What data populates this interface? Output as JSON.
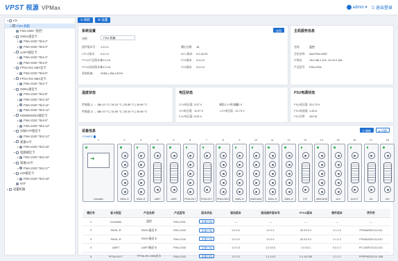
{
  "app": {
    "brand": "VPST",
    "brand_cn": "视源",
    "product": "VPMax",
    "user": "admin",
    "logout": "退出登录"
  },
  "toolbar": {
    "refresh": "刷新",
    "settings": "设置"
  },
  "tree": [
    {
      "label": "HX",
      "depth": 0,
      "type": "root",
      "tw": "▾"
    },
    {
      "label": "FWx-机箱",
      "depth": 1,
      "type": "root",
      "tw": "▾",
      "selected": true
    },
    {
      "label": "FWx-2000 \"监控\"",
      "depth": 2,
      "type": "dev",
      "tw": ""
    },
    {
      "label": "SWXL接近卡",
      "depth": 2,
      "type": "grp",
      "tw": "▾"
    },
    {
      "label": "FWx-2100 \"Slot 2\"",
      "depth": 3,
      "type": "dev",
      "tw": "▸"
    },
    {
      "label": "FWx-2100 \"Slot 3\"",
      "depth": 3,
      "type": "dev",
      "tw": "▸"
    },
    {
      "label": "UART接近卡",
      "depth": 2,
      "type": "grp",
      "tw": "▾"
    },
    {
      "label": "FWx-2100 \"Slot 4\"",
      "depth": 3,
      "type": "dev",
      "tw": "▸"
    },
    {
      "label": "FWx-2100 \"Slot 5\"",
      "depth": 3,
      "type": "dev",
      "tw": "▸"
    },
    {
      "label": "FPGA-R4 UMA近卡",
      "depth": 2,
      "type": "grp",
      "tw": "▾"
    },
    {
      "label": "FWx-2100 \"Slot 6\"",
      "depth": 3,
      "type": "dev",
      "tw": "▸"
    },
    {
      "label": "FPGA-R4 HMA近卡",
      "depth": 2,
      "type": "grp",
      "tw": "▾"
    },
    {
      "label": "FWx-2100 \"Slot 7\"",
      "depth": 3,
      "type": "dev",
      "tw": "▸"
    },
    {
      "label": "SWKL接近卡",
      "depth": 2,
      "type": "grp",
      "tw": "▾"
    },
    {
      "label": "FWx-2100 \"Slot 8\"",
      "depth": 3,
      "type": "dev",
      "tw": "▸"
    },
    {
      "label": "FWx-2100 \"Slot 10\"",
      "depth": 3,
      "type": "dev",
      "tw": "▸"
    },
    {
      "label": "FWx-2100 \"Slot 11\"",
      "depth": 3,
      "type": "dev",
      "tw": "▸"
    },
    {
      "label": "FWx-2100 \"Slot 12\"",
      "depth": 3,
      "type": "dev",
      "tw": "▸"
    },
    {
      "label": "HDMI/MODIO接近卡",
      "depth": 2,
      "type": "grp",
      "tw": "▾"
    },
    {
      "label": "FWx-2100 \"Slot 9\"",
      "depth": 3,
      "type": "dev",
      "tw": "▸"
    },
    {
      "label": "FWx-2100 \"Slot 13\"",
      "depth": 3,
      "type": "dev",
      "tw": "▸"
    },
    {
      "label": "分帧CTF接近卡",
      "depth": 2,
      "type": "grp",
      "tw": "▾"
    },
    {
      "label": "FWx-2100 \"Slot 14\"",
      "depth": 3,
      "type": "dev",
      "tw": "▸"
    },
    {
      "label": "高速AI卡",
      "depth": 2,
      "type": "grp",
      "tw": "▾"
    },
    {
      "label": "FWx-2100 \"Slot 15\"",
      "depth": 3,
      "type": "dev",
      "tw": "▸"
    },
    {
      "label": "电源接近卡",
      "depth": 2,
      "type": "grp",
      "tw": "▾"
    },
    {
      "label": "FWx-2100 \"Slot 16\"",
      "depth": 3,
      "type": "dev",
      "tw": "▸"
    },
    {
      "label": "高速AO卡",
      "depth": 2,
      "type": "grp",
      "tw": "▾"
    },
    {
      "label": "FWx-2100 \"Slot 17\"",
      "depth": 3,
      "type": "dev",
      "tw": "▸"
    },
    {
      "label": "CDI接近卡",
      "depth": 2,
      "type": "grp",
      "tw": "▾"
    },
    {
      "label": "FWx-2100 \"Slot 18\"",
      "depth": 3,
      "type": "dev",
      "tw": "▸"
    },
    {
      "label": "NTF",
      "depth": 2,
      "type": "dev",
      "tw": ""
    },
    {
      "label": "设置机箱",
      "depth": 0,
      "type": "root",
      "tw": "▸"
    }
  ],
  "sys": {
    "title": "系统设置",
    "apply": "应用",
    "name_label": "名称",
    "name_value": "FWx-机箱",
    "rows_left": [
      {
        "k": "固件版本号",
        "v": "1.0.0.1"
      },
      {
        "k": "CPLD版本",
        "v": "0.0.0.2"
      },
      {
        "k": "FPGA产品版本号",
        "v": "0.0.2.15"
      },
      {
        "k": "FPGA测试版本号",
        "v": "0.0.2.15"
      },
      {
        "k": "系统机箱",
        "v": "ZX65-LJ9A-LZ0Y0"
      }
    ],
    "rows_right": [
      {
        "k": "槽位总数",
        "v": "18"
      },
      {
        "k": "MCU版本",
        "v": "0.0.18.23"
      },
      {
        "k": "PCB版本",
        "v": "0.0.0.0"
      },
      {
        "k": "PCB版本",
        "v": "0.0.0.0"
      }
    ]
  },
  "host": {
    "title": "主机服务信息",
    "rows": [
      {
        "k": "名称",
        "v": "监控"
      },
      {
        "k": "主机名称",
        "v": "Null-FWx-0087"
      },
      {
        "k": "IP地址",
        "v": "192.168.1.101, 10.23.2.164"
      },
      {
        "k": "产品型号",
        "v": "FWx-2201"
      }
    ]
  },
  "temp": {
    "title": "温度状态",
    "rows": [
      {
        "k": "传感器 (1 → 4)",
        "v": "34.10 °C | 34.10 °C | 32.80 °C | 34.60 °C"
      },
      {
        "k": "传感器 (5 → 8)",
        "v": "30.10 °C | 31.60 °C | 34.10 °C | 30.60 °C"
      }
    ]
  },
  "volt": {
    "title": "电压状态",
    "rows": [
      {
        "k": "3.3V电压值",
        "v": "3.37 V",
        "k2": "辅助3.3V电压值",
        "v2": "3.32 V"
      },
      {
        "k": "12V电压值",
        "v": "11.97 V",
        "k2": "-12V电压值",
        "v2": "-12.73 V"
      },
      {
        "k": "5.0V电压值",
        "v": "5.02 V",
        "k2": "",
        "v2": ""
      }
    ]
  },
  "psu": {
    "title": "PSU电源状态",
    "rows": [
      {
        "k": "PSU电压值",
        "v": "221.70 V"
      },
      {
        "k": "PSU电流值",
        "v": "1.43 A"
      },
      {
        "k": "PSU功率",
        "v": "244 W"
      }
    ]
  },
  "devinfo": {
    "title": "设备信息",
    "power": "POWER",
    "btn_refresh": "刷新",
    "btn_toggle": "切换",
    "controller_label": "Controller",
    "cards": [
      {
        "num": "2",
        "label": "SWXL-R",
        "kind": "ports"
      },
      {
        "num": "3",
        "label": "SWXL-R",
        "kind": "ports"
      },
      {
        "num": "4",
        "label": "UART",
        "kind": "dsub"
      },
      {
        "num": "5",
        "label": "UART",
        "kind": "dsub"
      },
      {
        "num": "6",
        "label": "FPGA-R4 T",
        "kind": "ports"
      },
      {
        "num": "7",
        "label": "FPGA-R4 T",
        "kind": "dsub"
      },
      {
        "num": "8",
        "label": "FPGA-HM R",
        "kind": "ports"
      },
      {
        "num": "9",
        "label": "SWKL-R",
        "kind": "ports"
      },
      {
        "num": "10",
        "label": "HDMI-MOD",
        "kind": "ports"
      },
      {
        "num": "11",
        "label": "SWKL-R",
        "kind": "ports"
      },
      {
        "num": "12",
        "label": "SWKL-R",
        "kind": "ports"
      },
      {
        "num": "13",
        "label": "CTF",
        "kind": "dsub"
      },
      {
        "num": "14",
        "label": "HDMI-MOD",
        "kind": "ports"
      },
      {
        "num": "15",
        "label": "AI-5",
        "kind": "ports"
      },
      {
        "num": "16",
        "label": "AI-5 CT",
        "kind": "dsub"
      },
      {
        "num": "17",
        "label": "AO",
        "kind": "dsub"
      },
      {
        "num": "18",
        "label": "CDI",
        "kind": "dsub"
      }
    ],
    "table_headers": [
      "槽位号",
      "板卡类型",
      "产品名称",
      "产品型号",
      "版本状态",
      "驱动版本",
      "驱动固件版本号",
      "FPGA版本",
      "硬件版本",
      "序列号"
    ],
    "rows": [
      [
        "1",
        "Controller",
        "监控",
        "FWx-2201",
        "正常工作",
        "—",
        "—",
        "—",
        "—",
        "—"
      ],
      [
        "2",
        "SWXL-R",
        "SWXL接近卡",
        "FWx-2100",
        "正常工作",
        "1.0.2.2",
        "1.0.2.1",
        "02.02.0.2",
        "1.1.1.2",
        "FF0482023-01-011"
      ],
      [
        "3",
        "SWXL-R",
        "SWXL接近卡",
        "FWx-2100",
        "正常工作",
        "1.0.2.2",
        "1.0.2.1",
        "02.02.0.2",
        "1.1.1.2",
        "FF0482023-01-012"
      ],
      [
        "4",
        "UART",
        "UART接近卡",
        "FWx-2150",
        "正常工作",
        "1.0.0.3",
        "1.0.10.0",
        "1.0.10.1",
        "0.0.1.7",
        "FF-UART23-01-011"
      ],
      [
        "5",
        "FPGA-R4 T",
        "FPGA-R4 UMA近卡",
        "FWx-2102",
        "正常工作",
        "1.0.2.2",
        "1.1.14.3",
        "1.0.16.150",
        "1.1.1.1",
        "FPPP92022-01-008"
      ]
    ]
  }
}
